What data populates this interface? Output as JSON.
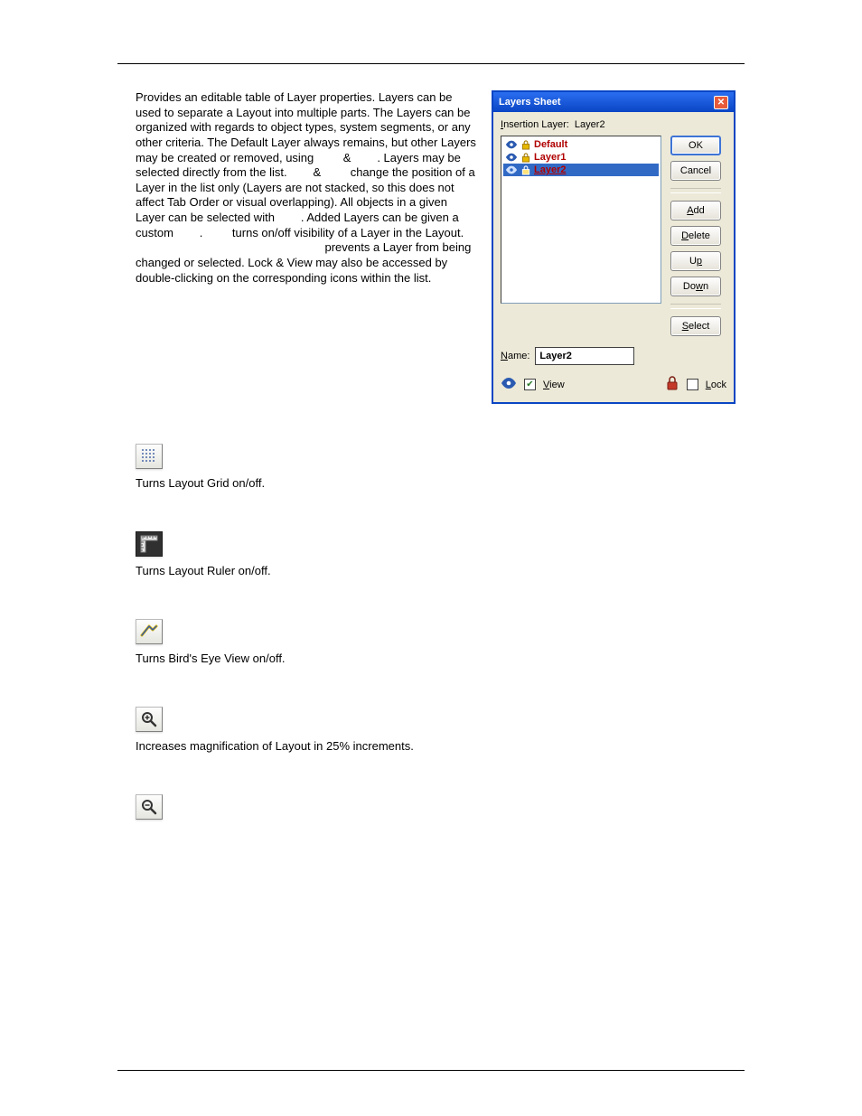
{
  "main": {
    "paragraph": "Provides an editable table of Layer properties. Layers can be used to separate a Layout into multiple parts. The Layers can be organized with regards to object types, system segments, or any other criteria. The Default Layer always remains, but other Layers may be created or removed, using         &        . Layers may be selected directly from the list.        &         change the position of a Layer in the list only (Layers are not stacked, so this does not affect Tab Order or visual overlapping). All objects in a given Layer can be selected with        . Added Layers can be given a custom        .         turns on/off visibility of a Layer in the Layout.                                                           prevents a Layer from being changed or selected. Lock & View may also be accessed by double-clicking on the corresponding icons within the list."
  },
  "dialog": {
    "title": "Layers Sheet",
    "insertion_label": "Insertion Layer:  Layer2",
    "items": [
      {
        "name": "Default",
        "selected": false
      },
      {
        "name": "Layer1",
        "selected": false
      },
      {
        "name": "Layer2",
        "selected": true
      }
    ],
    "buttons": {
      "ok": "OK",
      "cancel": "Cancel",
      "add": "Add",
      "delete": "Delete",
      "up": "Up",
      "down": "Down",
      "select": "Select"
    },
    "name_label": "Name:",
    "name_value": "Layer2",
    "view_label": "View",
    "lock_label": "Lock",
    "view_checked": true,
    "lock_checked": false
  },
  "sections": {
    "grid": "Turns Layout Grid on/off.",
    "ruler": "Turns Layout Ruler on/off.",
    "bird": "Turns Bird's Eye View on/off.",
    "zoomin": "Increases magnification of Layout in 25% increments."
  }
}
